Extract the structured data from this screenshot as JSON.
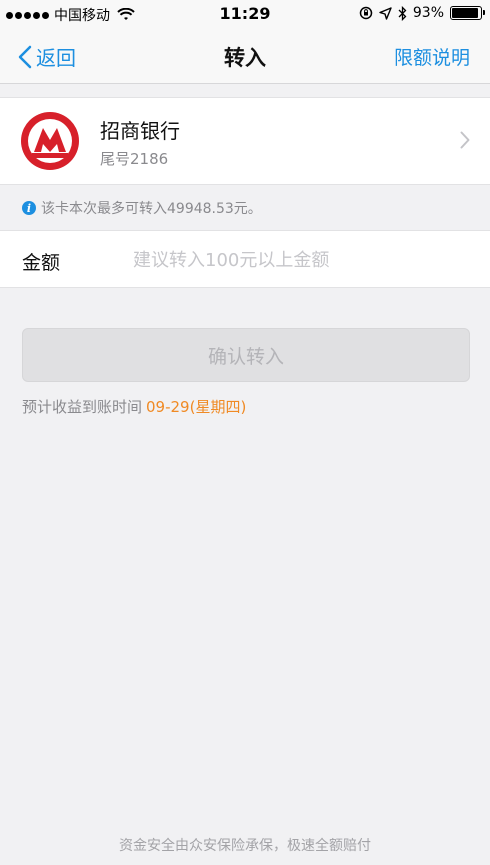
{
  "status_bar": {
    "carrier": "中国移动",
    "time": "11:29",
    "battery": "93%",
    "battery_level": 0.93
  },
  "nav": {
    "back_label": "返回",
    "title": "转入",
    "right_label": "限额说明"
  },
  "bank_card": {
    "name": "招商银行",
    "tail": "尾号2186",
    "logo_color": "#d7202a"
  },
  "info": {
    "text": "该卡本次最多可转入49948.53元。"
  },
  "amount": {
    "label": "金额",
    "placeholder": "建议转入100元以上金额",
    "value": ""
  },
  "confirm_button": {
    "label": "确认转入"
  },
  "eta": {
    "label": "预计收益到账时间",
    "date": "09-29(星期四)"
  },
  "footer": {
    "text": "资金安全由众安保险承保，极速全额赔付"
  },
  "colors": {
    "accent": "#1d8fe0",
    "highlight": "#f08a24",
    "background": "#f1f1f3"
  }
}
